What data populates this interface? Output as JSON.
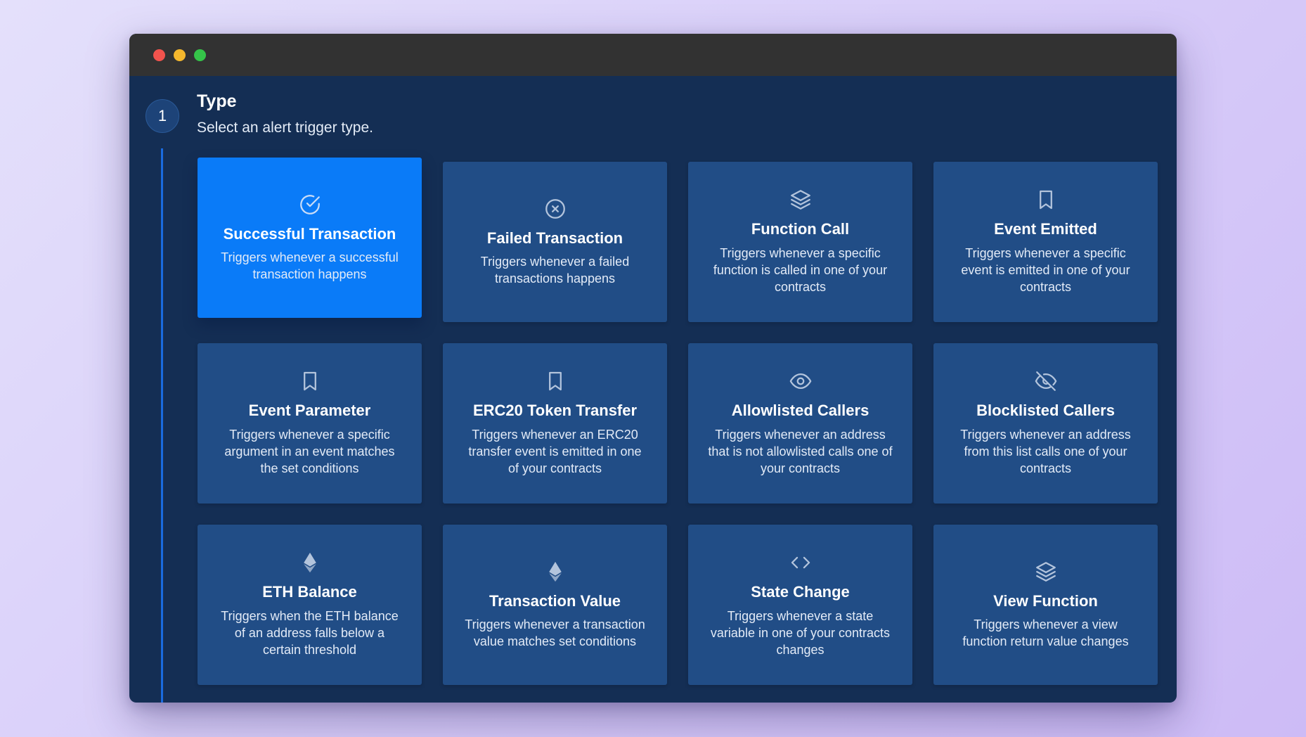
{
  "step": {
    "number": "1",
    "title": "Type",
    "subtitle": "Select an alert trigger type."
  },
  "colors": {
    "card": "#214d86",
    "selected_card": "#0a7bf8",
    "window_bg": "#142e54",
    "step_line": "#1a6be0"
  },
  "cards": [
    {
      "title": "Successful Transaction",
      "desc": "Triggers whenever a successful transaction happens",
      "icon": "check-circle-icon",
      "selected": true
    },
    {
      "title": "Failed Transaction",
      "desc": "Triggers whenever a failed transactions happens",
      "icon": "x-circle-icon",
      "selected": false
    },
    {
      "title": "Function Call",
      "desc": "Triggers whenever a specific function is called in one of your contracts",
      "icon": "layers-icon",
      "selected": false
    },
    {
      "title": "Event Emitted",
      "desc": "Triggers whenever a specific event is emitted in one of your contracts",
      "icon": "bookmark-icon",
      "selected": false
    },
    {
      "title": "Event Parameter",
      "desc": "Triggers whenever a specific argument in an event matches the set conditions",
      "icon": "bookmark-icon",
      "selected": false
    },
    {
      "title": "ERC20 Token Transfer",
      "desc": "Triggers whenever an ERC20 transfer event is emitted in one of your contracts",
      "icon": "bookmark-icon",
      "selected": false
    },
    {
      "title": "Allowlisted Callers",
      "desc": "Triggers whenever an address that is not allowlisted calls one of your contracts",
      "icon": "eye-icon",
      "selected": false
    },
    {
      "title": "Blocklisted Callers",
      "desc": "Triggers whenever an address from this list calls one of your contracts",
      "icon": "eye-off-icon",
      "selected": false
    },
    {
      "title": "ETH Balance",
      "desc": "Triggers when the ETH balance of an address falls below a certain threshold",
      "icon": "ethereum-icon",
      "selected": false
    },
    {
      "title": "Transaction Value",
      "desc": "Triggers whenever a transaction value matches set conditions",
      "icon": "ethereum-icon",
      "selected": false
    },
    {
      "title": "State Change",
      "desc": "Triggers whenever a state variable in one of your contracts changes",
      "icon": "code-icon",
      "selected": false
    },
    {
      "title": "View Function",
      "desc": "Triggers whenever a view function return value changes",
      "icon": "layers-icon",
      "selected": false
    }
  ]
}
